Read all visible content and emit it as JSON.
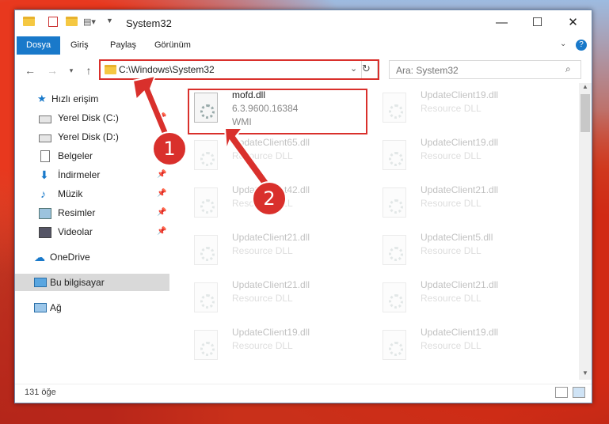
{
  "window": {
    "title": "System32",
    "min_icon": "minimize-icon",
    "max_icon": "maximize-icon",
    "close_icon": "close-icon"
  },
  "ribbon": {
    "tabs": [
      {
        "label": "Dosya",
        "active": true
      },
      {
        "label": "Giriş",
        "active": false
      },
      {
        "label": "Paylaş",
        "active": false
      },
      {
        "label": "Görünüm",
        "active": false
      }
    ]
  },
  "address": {
    "path": "C:\\Windows\\System32",
    "search_placeholder": "Ara: System32"
  },
  "sidebar": {
    "items": [
      {
        "label": "Hızlı erişim",
        "icon": "star-icon",
        "pinned": false
      },
      {
        "label": "Yerel Disk (C:)",
        "icon": "drive-icon",
        "pinned": true
      },
      {
        "label": "Yerel Disk (D:)",
        "icon": "drive-icon",
        "pinned": false
      },
      {
        "label": "Belgeler",
        "icon": "document-icon",
        "pinned": false
      },
      {
        "label": "İndirmeler",
        "icon": "download-icon",
        "pinned": true
      },
      {
        "label": "Müzik",
        "icon": "music-icon",
        "pinned": true
      },
      {
        "label": "Resimler",
        "icon": "picture-icon",
        "pinned": true
      },
      {
        "label": "Videolar",
        "icon": "video-icon",
        "pinned": true
      },
      {
        "label": "OneDrive",
        "icon": "cloud-icon",
        "pinned": false
      },
      {
        "label": "Bu bilgisayar",
        "icon": "computer-icon",
        "pinned": false,
        "selected": true
      },
      {
        "label": "Ağ",
        "icon": "network-icon",
        "pinned": false
      }
    ]
  },
  "files": {
    "highlighted": {
      "name": "mofd.dll",
      "version": "6.3.9600.16384",
      "description": "WMI"
    },
    "left_column": [
      {
        "name": "UpdateClient65.dll",
        "type": "Resource DLL"
      },
      {
        "name": "UpdateClient42.dll",
        "type": "Resource DLL"
      },
      {
        "name": "UpdateClient21.dll",
        "type": "Resource DLL"
      },
      {
        "name": "UpdateClient21.dll",
        "type": "Resource DLL"
      },
      {
        "name": "UpdateClient19.dll",
        "type": "Resource DLL"
      }
    ],
    "right_column": [
      {
        "name": "UpdateClient19.dll",
        "type": "Resource DLL"
      },
      {
        "name": "UpdateClient19.dll",
        "type": "Resource DLL"
      },
      {
        "name": "UpdateClient21.dll",
        "type": "Resource DLL"
      },
      {
        "name": "UpdateClient5.dll",
        "type": "Resource DLL"
      },
      {
        "name": "UpdateClient21.dll",
        "type": "Resource DLL"
      },
      {
        "name": "UpdateClient19.dll",
        "type": "Resource DLL"
      }
    ]
  },
  "status": {
    "count": "131 öğe"
  },
  "callouts": [
    "1",
    "2"
  ],
  "colors": {
    "accent": "#1979ca",
    "highlight": "#d9302c"
  }
}
